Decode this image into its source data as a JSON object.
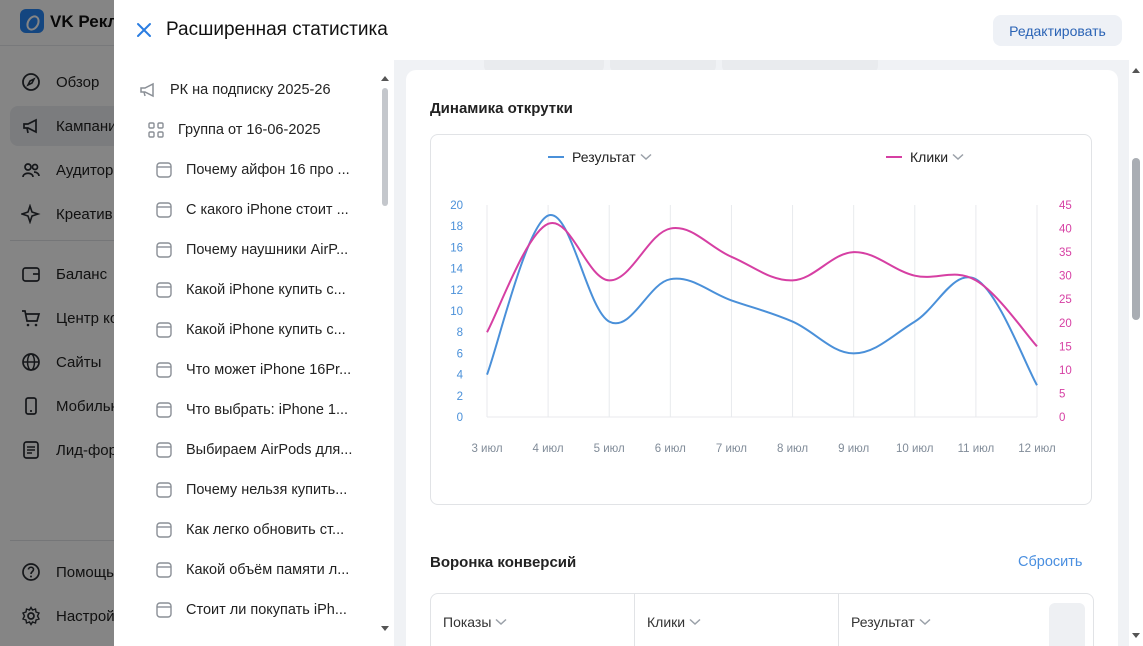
{
  "background_app": {
    "brand": "VK Рекл",
    "nav": [
      {
        "label": "Обзор",
        "icon": "compass-icon"
      },
      {
        "label": "Кампани",
        "icon": "megaphone-icon",
        "active": true
      },
      {
        "label": "Аудитор",
        "icon": "users-icon"
      },
      {
        "label": "Креатив",
        "icon": "sparkle-icon"
      },
      {
        "label": "Баланс",
        "icon": "wallet-icon"
      },
      {
        "label": "Центр ко",
        "icon": "cart-icon"
      },
      {
        "label": "Сайты",
        "icon": "globe-icon"
      },
      {
        "label": "Мобильн",
        "icon": "phone-icon"
      },
      {
        "label": "Лид-фор",
        "icon": "form-icon"
      },
      {
        "label": "Помощь",
        "icon": "help-icon"
      },
      {
        "label": "Настрой",
        "icon": "gear-icon"
      }
    ]
  },
  "modal": {
    "title": "Расширенная статистика",
    "edit_label": "Редактировать"
  },
  "tree": {
    "campaign": "РК на подписку 2025-26",
    "group": "Группа от 16-06-2025",
    "ads": [
      "Почему айфон 16 про ...",
      "С какого iPhone стоит ...",
      "Почему наушники AirP...",
      "Какой iPhone купить с...",
      "Какой iPhone купить с...",
      "Что может iPhone 16Pr...",
      "Что выбрать: iPhone 1...",
      "Выбираем AirPods для...",
      "Почему нельзя купить...",
      "Как легко обновить ст...",
      "Какой объём памяти л...",
      "Стоит ли покупать iPh..."
    ]
  },
  "dynamics": {
    "title": "Динамика открутки"
  },
  "funnel": {
    "title": "Воронка конверсий",
    "reset_label": "Сбросить",
    "columns": [
      "Показы",
      "Клики",
      "Результат"
    ]
  },
  "colors": {
    "result": "#4a90d9",
    "clicks": "#d63fa3",
    "link": "#4a8fe0",
    "edit_text": "#2a63b5"
  },
  "chart_data": {
    "type": "line",
    "categories": [
      "3 июл",
      "4 июл",
      "5 июл",
      "6 июл",
      "7 июл",
      "8 июл",
      "9 июл",
      "10 июл",
      "11 июл",
      "12 июл"
    ],
    "series": [
      {
        "name": "Результат",
        "axis": "left",
        "values": [
          4,
          19,
          9,
          13,
          11,
          9,
          6,
          9,
          13,
          3
        ]
      },
      {
        "name": "Клики",
        "axis": "right",
        "values": [
          18,
          41,
          29,
          40,
          34,
          29,
          35,
          30,
          29,
          15
        ]
      }
    ],
    "y_left": {
      "range": [
        0,
        20
      ],
      "ticks": [
        0,
        2,
        4,
        6,
        8,
        10,
        12,
        14,
        16,
        18,
        20
      ]
    },
    "y_right": {
      "range": [
        0,
        45
      ],
      "ticks": [
        0,
        5,
        10,
        15,
        20,
        25,
        30,
        35,
        40,
        45
      ]
    },
    "grid": "vertical",
    "legend": "top"
  }
}
